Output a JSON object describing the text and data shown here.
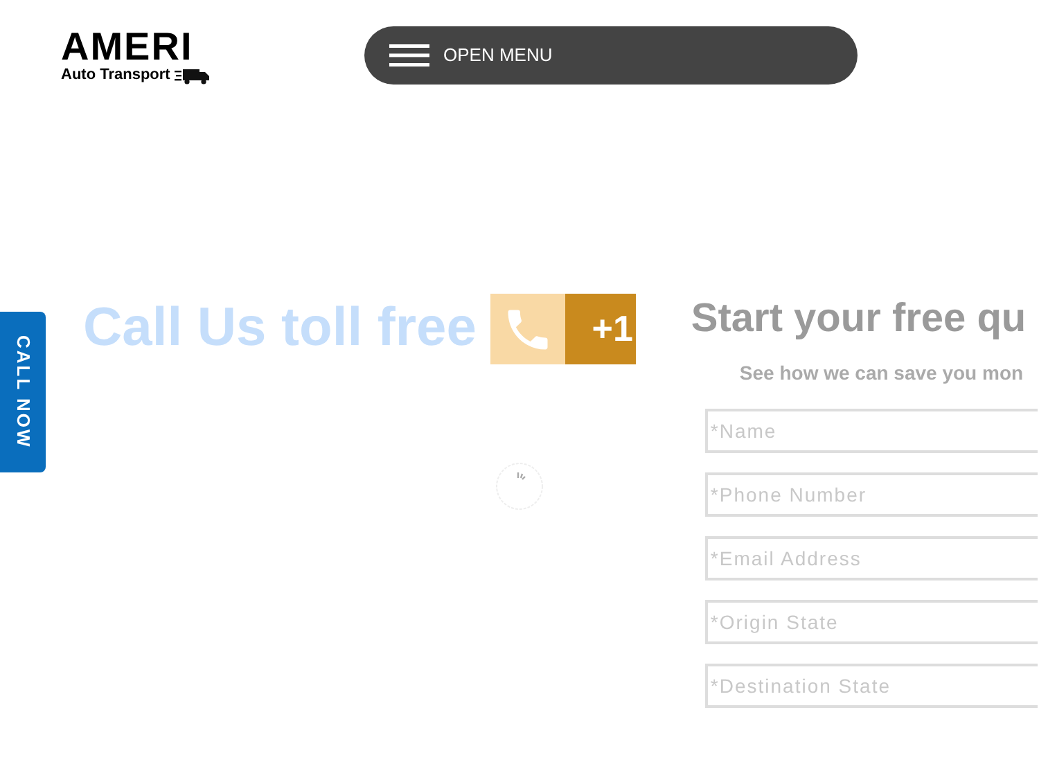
{
  "logo": {
    "title": "AMERI",
    "subtitle": "Auto Transport"
  },
  "menu_button": {
    "label": "OPEN MENU"
  },
  "call_now_tab": {
    "label": "CALL NOW"
  },
  "call_banner": {
    "headline": "Call Us toll free",
    "phone_prefix": "+1"
  },
  "quote_form": {
    "title": "Start your free qu",
    "subtitle": "See how we can save you mon",
    "fields": [
      {
        "placeholder": "*Name"
      },
      {
        "placeholder": "*Phone Number"
      },
      {
        "placeholder": "*Email Address"
      },
      {
        "placeholder": "*Origin State"
      },
      {
        "placeholder": "*Destination State"
      }
    ]
  }
}
